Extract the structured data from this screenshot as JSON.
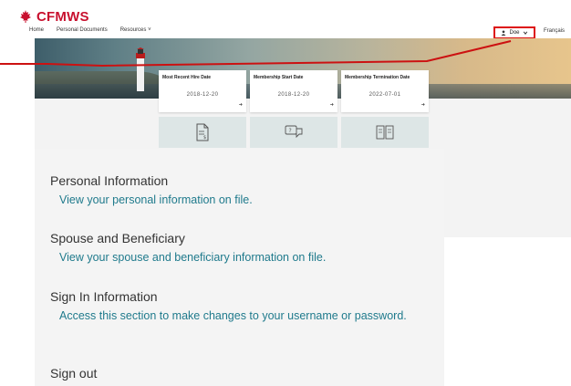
{
  "header": {
    "logo_text": "CFMWS",
    "nav": [
      "Home",
      "Personal Documents",
      "Resources ˅"
    ],
    "user_label": "Doe",
    "language_label": "Français"
  },
  "cards": [
    {
      "label": "Most Recent Hire Date",
      "value": "2018-12-20"
    },
    {
      "label": "Membership Start Date",
      "value": "2018-12-20"
    },
    {
      "label": "Membership Termination Date",
      "value": "2022-07-01"
    }
  ],
  "menu": {
    "personal_title": "Personal Information",
    "personal_link": "View your personal information on file.",
    "spouse_title": "Spouse and Beneficiary",
    "spouse_link": "View your spouse and beneficiary information on file.",
    "signin_title": "Sign In Information",
    "signin_link": "Access this section to make changes to your username or password.",
    "signout": "Sign out"
  },
  "colors": {
    "brand_red": "#c8102e",
    "link_teal": "#1f7a8c",
    "annotation_red": "#cc1111"
  },
  "icons": [
    "maple-leaf-icon",
    "user-icon",
    "chevron-down-icon",
    "document-icon",
    "chat-question-icon",
    "book-icon",
    "arrow-icon"
  ]
}
